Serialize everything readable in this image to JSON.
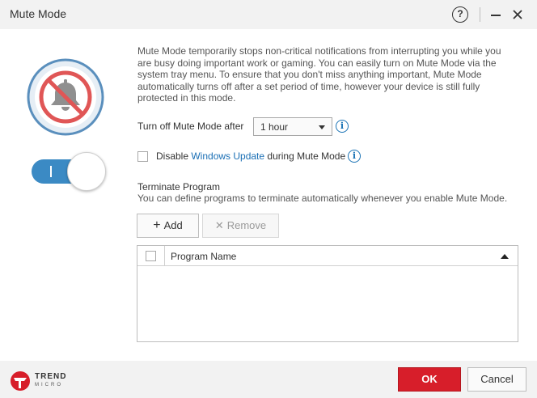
{
  "window": {
    "title": "Mute Mode",
    "help_icon": "question-icon",
    "help_glyph": "?",
    "minimize_icon": "minimize-icon",
    "close_icon": "close-icon"
  },
  "hero": {
    "icon": "muted-bell-icon",
    "toggle_state": "on",
    "toggle_glyph": "I"
  },
  "description": "Mute Mode temporarily stops non-critical notifications from interrupting you while you are busy doing important work or gaming. You can easily turn on Mute Mode via the system tray menu. To ensure that you don't miss anything important, Mute Mode automatically turns off after a set period of time, however your device is still fully protected in this mode.",
  "settings": {
    "turn_off_label": "Turn off Mute Mode after",
    "duration_selected": "1 hour",
    "info_glyph": "i",
    "disable_prefix": "Disable ",
    "disable_link": "Windows Update",
    "disable_suffix": " during Mute Mode",
    "disable_checked": false
  },
  "terminate": {
    "title": "Terminate Program",
    "description": "You can define programs to terminate automatically whenever you enable Mute Mode.",
    "add_glyph": "+",
    "add_label": "Add",
    "remove_glyph": "✕",
    "remove_label": "Remove",
    "table": {
      "columns": [
        "Program Name"
      ],
      "rows": []
    }
  },
  "footer": {
    "brand_line1": "TREND",
    "brand_line2": "MICRO",
    "ok_label": "OK",
    "cancel_label": "Cancel"
  },
  "colors": {
    "accent": "#3b8ac4",
    "link": "#1a6fb5",
    "ok": "#d71e2a",
    "muted_red": "#e05656"
  }
}
